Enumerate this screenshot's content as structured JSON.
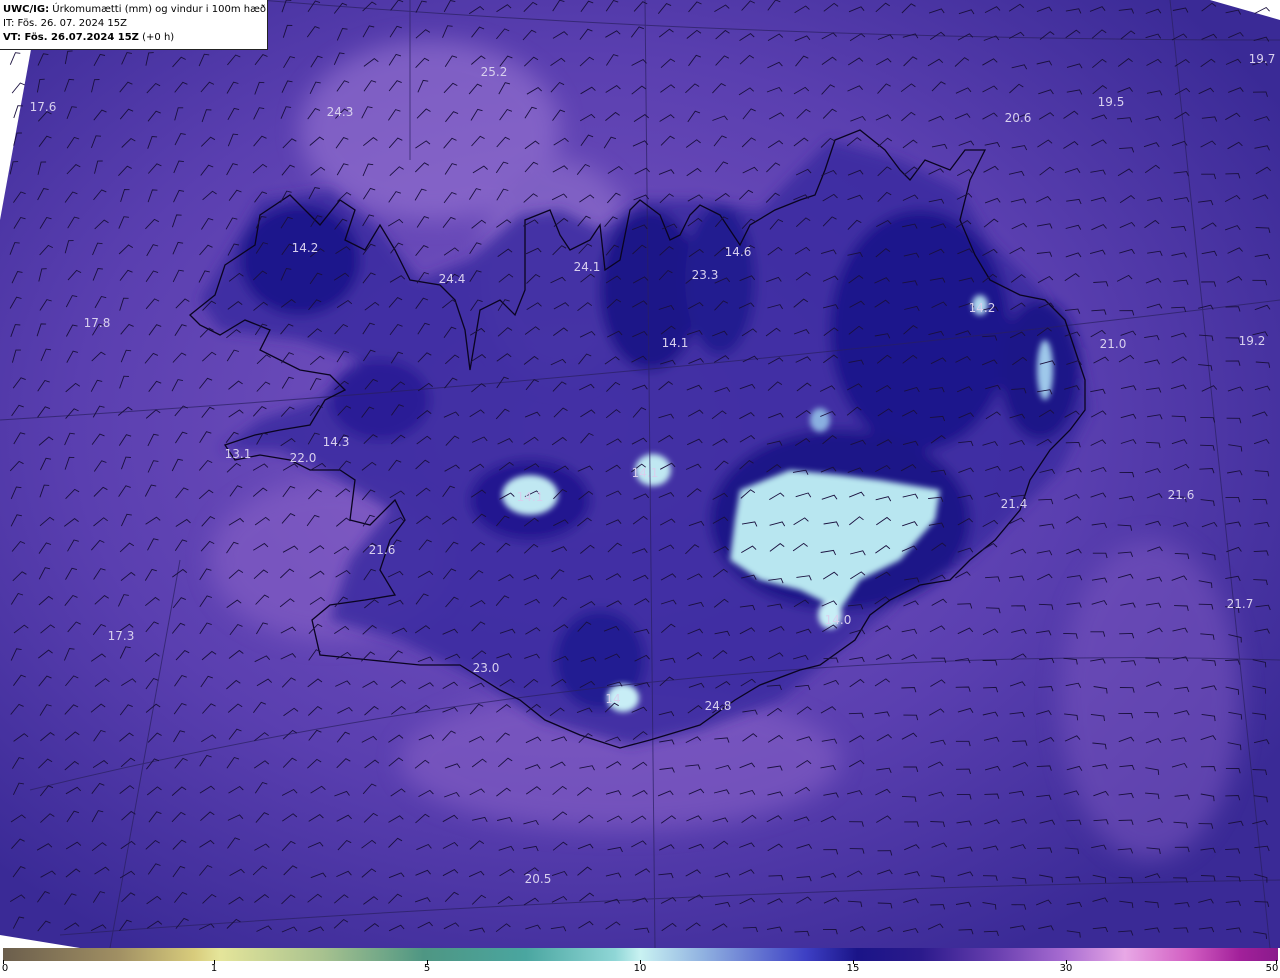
{
  "header": {
    "model": "UWC/IG:",
    "description": "Úrkomumætti (mm) og vindur i 100m hæð",
    "init_time": "IT: Fös. 26. 07. 2024 15Z",
    "valid_prefix": "VT: Fös. 26.07.2024 15Z",
    "valid_suffix": "(+0 h)"
  },
  "map_labels": [
    "25.2",
    "19.7",
    "17.6",
    "24.3",
    "19.5",
    "20.6",
    "14.2",
    "24.4",
    "24.1",
    "23.3",
    "14.6",
    "14.2",
    "17.8",
    "14.1",
    "21.0",
    "19.2",
    "13.1",
    "22.0",
    "14.3",
    "14.1",
    "14.1",
    "21.4",
    "21.6",
    "21.6",
    "17.3",
    "14.0",
    "21.7",
    "23.0",
    "14",
    "24.8",
    "20.5"
  ],
  "colorbar": {
    "ticks": [
      "0",
      "1",
      "5",
      "10",
      "15",
      "30",
      "50"
    ]
  },
  "colors": {
    "background": "#4e3ca0",
    "land": "#2a1a8a",
    "snow": "#b8e6f0",
    "label": "#d8d0ee"
  }
}
